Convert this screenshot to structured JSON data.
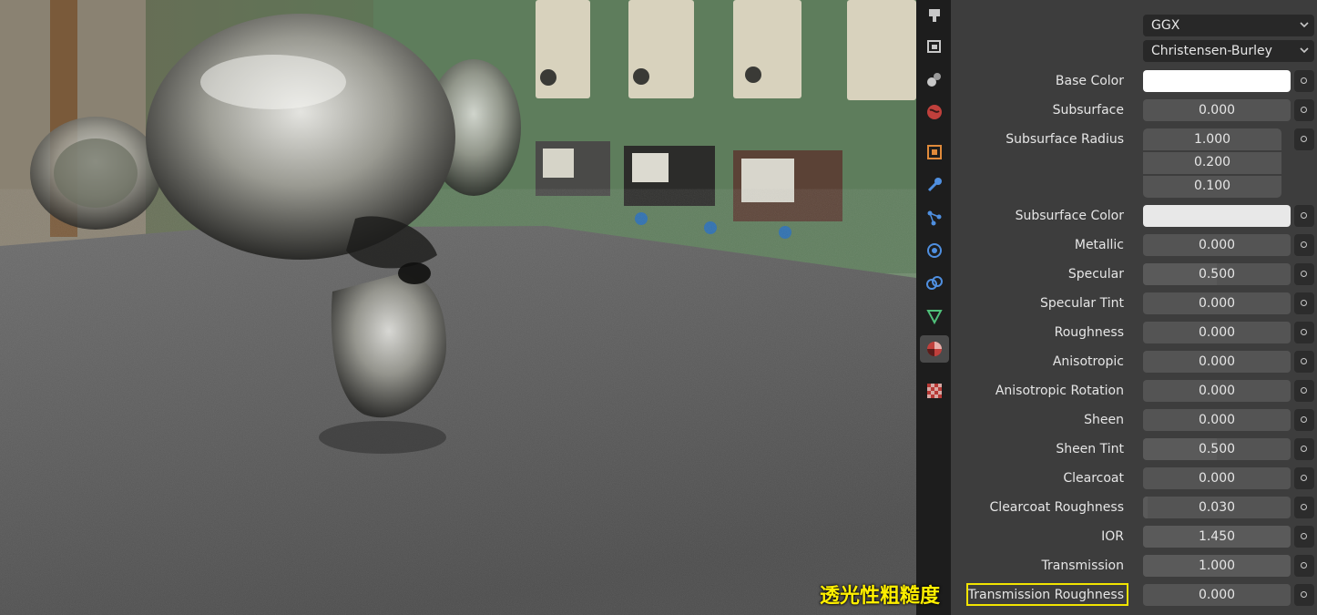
{
  "viewport": {
    "description_icon": "render-preview"
  },
  "tabs": [
    {
      "icon": "render-icon"
    },
    {
      "icon": "output-icon"
    },
    {
      "icon": "view-layer-icon"
    },
    {
      "icon": "scene-icon"
    },
    {
      "icon": "world-icon"
    },
    {
      "icon": "object-icon"
    },
    {
      "icon": "modifier-icon"
    },
    {
      "icon": "particles-icon"
    },
    {
      "icon": "physics-icon"
    },
    {
      "icon": "constraints-icon"
    },
    {
      "icon": "data-icon"
    },
    {
      "icon": "material-icon"
    },
    {
      "icon": "texture-icon"
    }
  ],
  "panel": {
    "distribution": "GGX",
    "subsurface_method": "Christensen-Burley",
    "base_color": {
      "label": "Base Color",
      "color": "#ffffff"
    },
    "subsurface": {
      "label": "Subsurface",
      "value": "0.000",
      "fill": 0.0
    },
    "subsurface_radius": {
      "label": "Subsurface Radius",
      "values": [
        "1.000",
        "0.200",
        "0.100"
      ]
    },
    "subsurface_color": {
      "label": "Subsurface Color",
      "color": "#e8e8e8"
    },
    "metallic": {
      "label": "Metallic",
      "value": "0.000",
      "fill": 0.0
    },
    "specular": {
      "label": "Specular",
      "value": "0.500",
      "fill": 0.5
    },
    "specular_tint": {
      "label": "Specular Tint",
      "value": "0.000",
      "fill": 0.0
    },
    "roughness": {
      "label": "Roughness",
      "value": "0.000",
      "fill": 0.0
    },
    "anisotropic": {
      "label": "Anisotropic",
      "value": "0.000",
      "fill": 0.0
    },
    "anisotropic_rotation": {
      "label": "Anisotropic Rotation",
      "value": "0.000",
      "fill": 0.0
    },
    "sheen": {
      "label": "Sheen",
      "value": "0.000",
      "fill": 0.0
    },
    "sheen_tint": {
      "label": "Sheen Tint",
      "value": "0.500",
      "fill": 0.5
    },
    "clearcoat": {
      "label": "Clearcoat",
      "value": "0.000",
      "fill": 0.0
    },
    "clearcoat_roughness": {
      "label": "Clearcoat Roughness",
      "value": "0.030",
      "fill": 0.03
    },
    "ior": {
      "label": "IOR",
      "value": "1.450",
      "fill": 1.0
    },
    "transmission": {
      "label": "Transmission",
      "value": "1.000",
      "fill": 1.0
    },
    "transmission_roughness": {
      "label": "Transmission Roughness",
      "value": "0.000",
      "fill": 0.0
    }
  },
  "annotation": {
    "text": "透光性粗糙度",
    "color": "#ffef00"
  }
}
